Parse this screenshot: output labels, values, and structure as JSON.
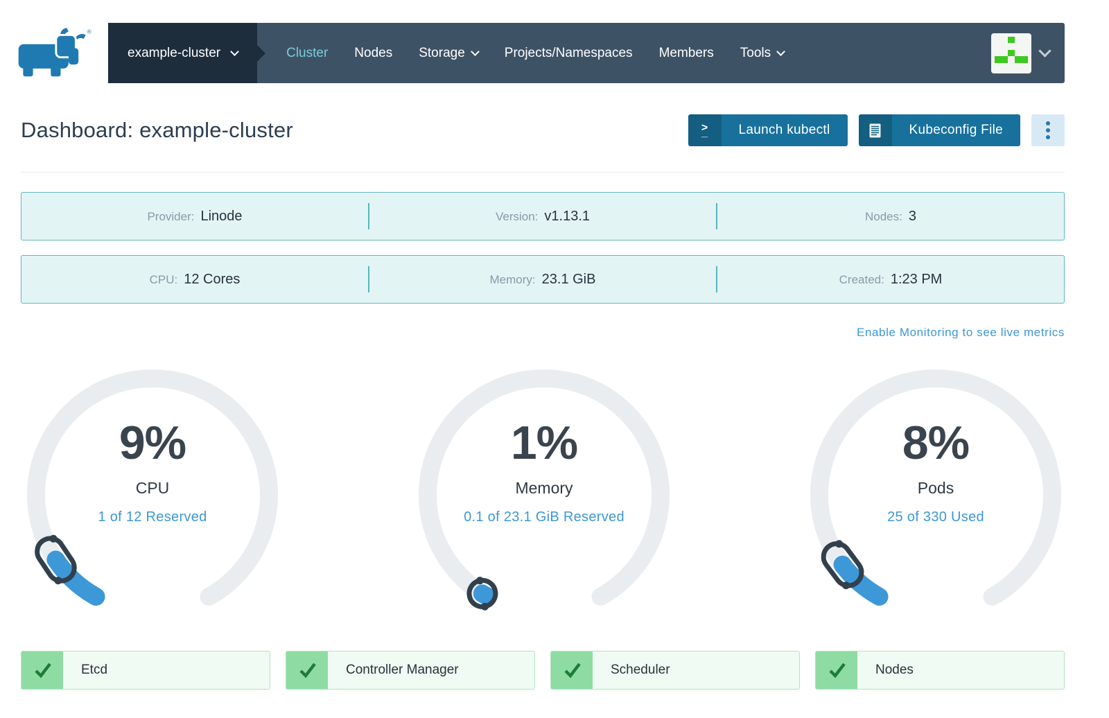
{
  "nav": {
    "cluster_selector": {
      "label": "example-cluster"
    },
    "items": [
      {
        "label": "Cluster",
        "active": true,
        "dropdown": false
      },
      {
        "label": "Nodes",
        "active": false,
        "dropdown": false
      },
      {
        "label": "Storage",
        "active": false,
        "dropdown": true
      },
      {
        "label": "Projects/Namespaces",
        "active": false,
        "dropdown": false
      },
      {
        "label": "Members",
        "active": false,
        "dropdown": false
      },
      {
        "label": "Tools",
        "active": false,
        "dropdown": true
      }
    ]
  },
  "header": {
    "title": "Dashboard: example-cluster",
    "actions": {
      "launch_kubectl": "Launch kubectl",
      "kubeconfig_file": "Kubeconfig File"
    }
  },
  "info_rows": {
    "row1": [
      {
        "label": "Provider:",
        "value": "Linode"
      },
      {
        "label": "Version:",
        "value": "v1.13.1"
      },
      {
        "label": "Nodes:",
        "value": "3"
      }
    ],
    "row2": [
      {
        "label": "CPU:",
        "value": "12 Cores"
      },
      {
        "label": "Memory:",
        "value": "23.1 GiB"
      },
      {
        "label": "Created:",
        "value": "1:23 PM"
      }
    ]
  },
  "monitoring_link": "Enable Monitoring to see live metrics",
  "chart_data": [
    {
      "type": "gauge",
      "label": "CPU",
      "percent": 9,
      "percent_label": "9%",
      "detail": "1 of 12 Reserved",
      "used": 1,
      "total": 12,
      "range": [
        0,
        100
      ]
    },
    {
      "type": "gauge",
      "label": "Memory",
      "percent": 1,
      "percent_label": "1%",
      "detail": "0.1 of 23.1 GiB Reserved",
      "used": 0.1,
      "total": 23.1,
      "unit": "GiB",
      "range": [
        0,
        100
      ]
    },
    {
      "type": "gauge",
      "label": "Pods",
      "percent": 8,
      "percent_label": "8%",
      "detail": "25 of 330 Used",
      "used": 25,
      "total": 330,
      "range": [
        0,
        100
      ]
    }
  ],
  "statuses": [
    {
      "label": "Etcd",
      "state": "healthy"
    },
    {
      "label": "Controller Manager",
      "state": "healthy"
    },
    {
      "label": "Scheduler",
      "state": "healthy"
    },
    {
      "label": "Nodes",
      "state": "healthy"
    }
  ],
  "avatar": {
    "pattern": [
      [
        0,
        0,
        1,
        0,
        0
      ],
      [
        0,
        0,
        0,
        0,
        0
      ],
      [
        0,
        0,
        1,
        0,
        0
      ],
      [
        1,
        1,
        0,
        1,
        1
      ],
      [
        0,
        0,
        0,
        0,
        0
      ]
    ],
    "color": "#3ec920",
    "background": "#f4f6f3"
  },
  "colors": {
    "nav_dark": "#1d2d3c",
    "nav_bg": "#3e5266",
    "nav_active": "#78cedb",
    "primary_blue": "#3d98d8",
    "button_teal": "#17719c",
    "button_icon_teal": "#135e81",
    "kebab_bg": "#d8e9f6",
    "info_bg": "#e3f4f5",
    "info_border": "#63b7bc",
    "gauge_track": "#eaedf0",
    "pointer": "#32404d",
    "badge_green": "#8edca4",
    "check_green": "#1e7b38",
    "badge_bg": "#f0fbf3",
    "link_blue": "#3c97d7",
    "logo_blue": "#1f7ab2"
  }
}
